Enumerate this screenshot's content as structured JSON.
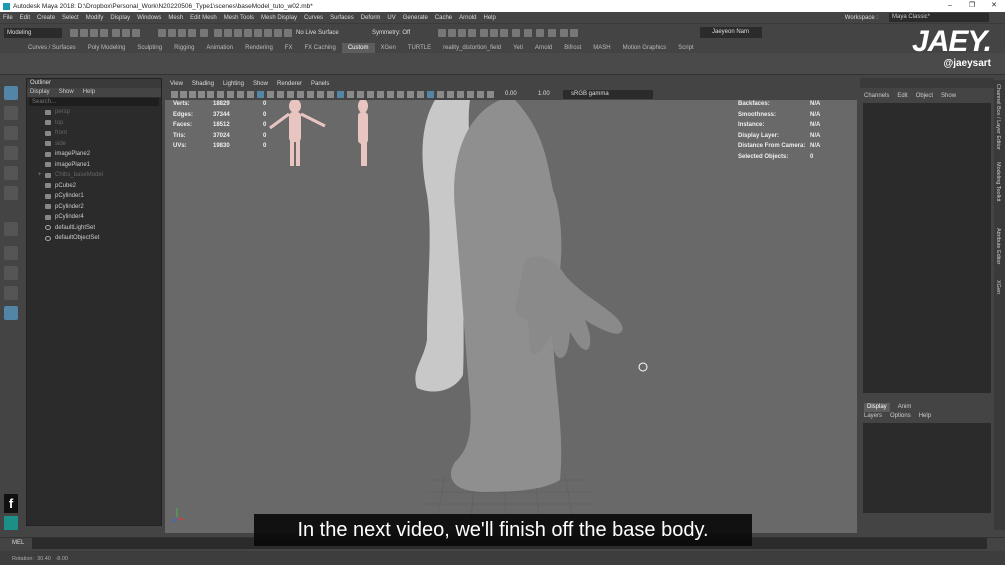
{
  "window": {
    "title": "Autodesk Maya 2018: D:\\Dropbox\\Personal_Work\\N20220506_Type1\\scenes\\baseModel_tuto_w02.mb*"
  },
  "menus": [
    "File",
    "Edit",
    "Create",
    "Select",
    "Modify",
    "Display",
    "Windows",
    "Mesh",
    "Edit Mesh",
    "Mesh Tools",
    "Mesh Display",
    "Curves",
    "Surfaces",
    "Deform",
    "UV",
    "Generate",
    "Cache",
    "Arnold",
    "Help"
  ],
  "workspace": {
    "label": "Workspace :",
    "value": "Maya Classic*"
  },
  "statusline": {
    "mode": "Modeling",
    "live_surface": "No Live Surface",
    "symmetry": "Symmetry: Off",
    "user": "Jaeyeon Nam"
  },
  "shelf_tabs": [
    "Curves / Surfaces",
    "Poly Modeling",
    "Sculpting",
    "Rigging",
    "Animation",
    "Rendering",
    "FX",
    "FX Caching",
    "Custom",
    "XGen",
    "TURTLE",
    "reality_distortion_field",
    "Yeti",
    "Arnold",
    "Bifrost",
    "MASH",
    "Motion Graphics",
    "Script"
  ],
  "shelf_active": "Custom",
  "outliner": {
    "title": "Outliner",
    "menu": [
      "Display",
      "Show",
      "Help"
    ],
    "search_placeholder": "Search...",
    "items": [
      {
        "label": "persp",
        "dim": true
      },
      {
        "label": "top",
        "dim": true
      },
      {
        "label": "front",
        "dim": true
      },
      {
        "label": "side",
        "dim": true
      },
      {
        "label": "imagePlane2",
        "dim": false
      },
      {
        "label": "imagePlane1",
        "dim": false
      },
      {
        "label": "Chibs_baseModel",
        "dim": true,
        "expand": true
      },
      {
        "label": "pCube2",
        "dim": false
      },
      {
        "label": "pCylinder1",
        "dim": false
      },
      {
        "label": "pCylinder2",
        "dim": false
      },
      {
        "label": "pCylinder4",
        "dim": false
      },
      {
        "label": "defaultLightSet",
        "dim": false,
        "set": true
      },
      {
        "label": "defaultObjectSet",
        "dim": false,
        "set": true
      }
    ]
  },
  "viewport": {
    "menu": [
      "View",
      "Shading",
      "Lighting",
      "Show",
      "Renderer",
      "Panels"
    ],
    "field_a": "0.00",
    "field_b": "1.00",
    "color_space": "sRGB gamma",
    "hud_left": [
      {
        "k": "Verts:",
        "v": "18829",
        "z": "0"
      },
      {
        "k": "Edges:",
        "v": "37344",
        "z": "0"
      },
      {
        "k": "Faces:",
        "v": "18512",
        "z": "0"
      },
      {
        "k": "Tris:",
        "v": "37024",
        "z": "0"
      },
      {
        "k": "UVs:",
        "v": "19830",
        "z": "0"
      }
    ],
    "hud_right": [
      {
        "k": "Backfaces:",
        "v": "N/A"
      },
      {
        "k": "Smoothness:",
        "v": "N/A"
      },
      {
        "k": "Instance:",
        "v": "N/A"
      },
      {
        "k": "Display Layer:",
        "v": "N/A"
      },
      {
        "k": "Distance From Camera:",
        "v": "N/A"
      },
      {
        "k": "Selected Objects:",
        "v": "0"
      }
    ]
  },
  "channel_box": {
    "menu": [
      "Channels",
      "Edit",
      "Object",
      "Show"
    ]
  },
  "layer_panel": {
    "tabs": [
      "Display",
      "Anim"
    ],
    "menu": [
      "Layers",
      "Options",
      "Help"
    ]
  },
  "side_tabs": [
    "Channel Box / Layer Editor",
    "Modeling Toolkit",
    "Attribute Editor",
    "XGen"
  ],
  "command_line": {
    "label": "MEL"
  },
  "help_line": {
    "rotation_label": "Rotation:",
    "rotation_x": "30.40",
    "rotation_y": "-8.00"
  },
  "subtitle": "In the next video, we'll finish off the base body.",
  "branding": {
    "logo": "JAEY.",
    "handle": "@jaeysart",
    "social": "f"
  }
}
